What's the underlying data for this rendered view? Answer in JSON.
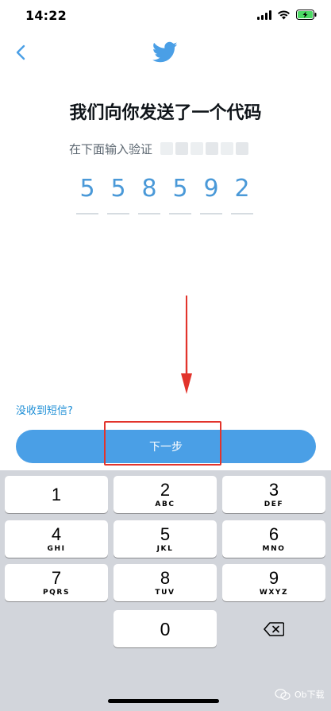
{
  "status_bar": {
    "time": "14:22"
  },
  "header": {
    "back_icon": "chevron-left-icon",
    "logo_icon": "twitter-bird-icon"
  },
  "main": {
    "title": "我们向你发送了一个代码",
    "subtitle": "在下面输入验证",
    "code_digits": [
      "5",
      "5",
      "8",
      "5",
      "9",
      "2"
    ],
    "resend_link": "没收到短信?",
    "next_button": "下一步"
  },
  "keyboard": {
    "keys": [
      {
        "num": "1",
        "letters": ""
      },
      {
        "num": "2",
        "letters": "ABC"
      },
      {
        "num": "3",
        "letters": "DEF"
      },
      {
        "num": "4",
        "letters": "GHI"
      },
      {
        "num": "5",
        "letters": "JKL"
      },
      {
        "num": "6",
        "letters": "MNO"
      },
      {
        "num": "7",
        "letters": "PQRS"
      },
      {
        "num": "8",
        "letters": "TUV"
      },
      {
        "num": "9",
        "letters": "WXYZ"
      },
      {
        "num": "0",
        "letters": ""
      }
    ],
    "delete_icon": "backspace-icon"
  },
  "watermark": {
    "text": "Ob下载"
  },
  "colors": {
    "accent": "#4a9fe6",
    "code_digit": "#4a99d8",
    "highlight": "#e2342c",
    "keyboard_bg": "#d2d5db"
  }
}
